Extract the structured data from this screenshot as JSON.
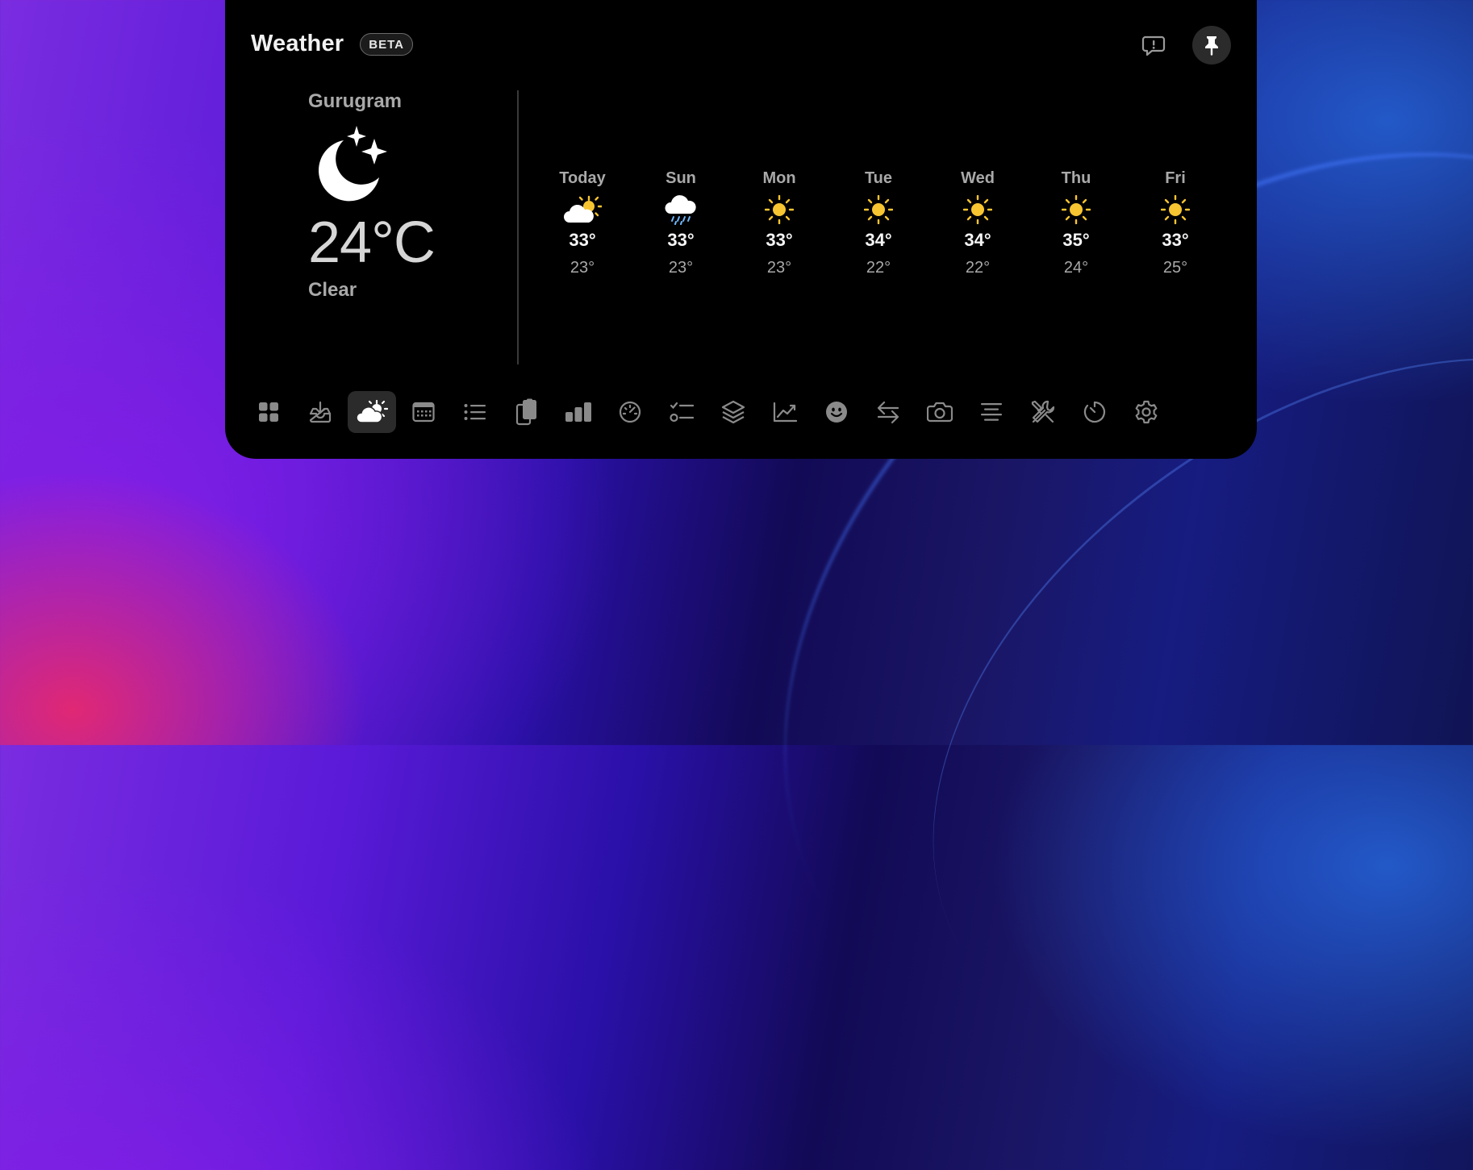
{
  "app": {
    "title": "Weather",
    "badge": "BETA"
  },
  "header": {
    "feedback_icon": "feedback-icon",
    "pin_icon": "pin-icon"
  },
  "current": {
    "city": "Gurugram",
    "icon": "moon-stars-icon",
    "temperature": "24°C",
    "condition": "Clear"
  },
  "forecast": [
    {
      "day": "Today",
      "icon": "partly-cloudy-icon",
      "high": "33°",
      "low": "23°"
    },
    {
      "day": "Sun",
      "icon": "rain-cloud-icon",
      "high": "33°",
      "low": "23°"
    },
    {
      "day": "Mon",
      "icon": "sun-icon",
      "high": "33°",
      "low": "23°"
    },
    {
      "day": "Tue",
      "icon": "sun-icon",
      "high": "34°",
      "low": "22°"
    },
    {
      "day": "Wed",
      "icon": "sun-icon",
      "high": "34°",
      "low": "22°"
    },
    {
      "day": "Thu",
      "icon": "sun-icon",
      "high": "35°",
      "low": "24°"
    },
    {
      "day": "Fri",
      "icon": "sun-icon",
      "high": "33°",
      "low": "25°"
    }
  ],
  "toolbar": {
    "active": "weather",
    "items": [
      "grid-icon",
      "inbox-download-icon",
      "weather-icon",
      "calendar-icon",
      "list-icon",
      "clipboard-icon",
      "bar-chart-icon",
      "speedometer-icon",
      "checklist-icon",
      "layers-icon",
      "line-chart-icon",
      "emoji-icon",
      "arrows-swap-icon",
      "camera-icon",
      "text-align-icon",
      "tools-icon",
      "timer-icon",
      "settings-gear-icon"
    ]
  },
  "colors": {
    "sun": "#f7c531",
    "panel": "#000000",
    "muted": "#a9a9a9",
    "active_tool_bg": "#2b2b2b"
  }
}
